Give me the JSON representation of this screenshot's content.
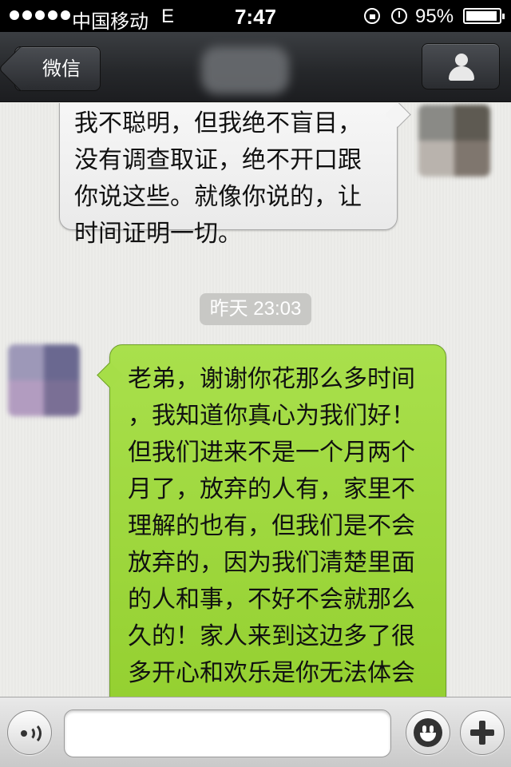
{
  "status_bar": {
    "carrier": "中国移动",
    "network": "E",
    "time": "7:47",
    "battery_percent": "95%",
    "battery_level": 0.95
  },
  "nav": {
    "back_label": "微信",
    "profile_icon": "person-icon"
  },
  "messages": [
    {
      "direction": "incoming",
      "text": "我不聪明，但我绝不盲目，\n没有调查取证，绝不开口跟\n你说这些。就像你说的，让\n时间证明一切。"
    },
    {
      "direction": "outgoing",
      "text": "老弟，谢谢你花那么多时间\n，我知道你真心为我们好！\n但我们进来不是一个月两个\n月了，放弃的人有，家里不\n理解的也有，但我们是不会\n放弃的，因为我们清楚里面\n的人和事，不好不会就那么\n久的！家人来到这边多了很\n多开心和欢乐是你无法体会\n的！除了钱我们还有更多的\n东西让我们更喜欢今天的生"
    }
  ],
  "timestamp": "昨天 23:03",
  "input_bar": {
    "message_value": "",
    "voice_icon": "voice-icon",
    "emoji_icon": "smile-icon",
    "plus_icon": "plus-icon"
  },
  "colors": {
    "outgoing_bubble": "#9ad63a",
    "incoming_bubble": "#f2f2f2",
    "nav_bar": "#2a2c30"
  }
}
